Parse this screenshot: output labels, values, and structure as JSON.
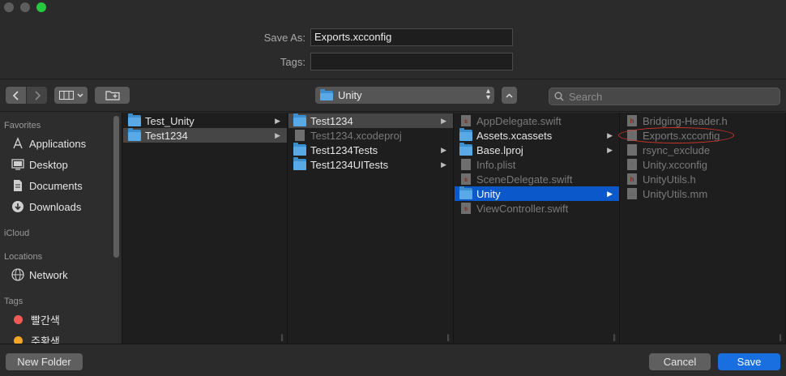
{
  "form": {
    "save_as_label": "Save As:",
    "save_as_value": "Exports.xcconfig",
    "tags_label": "Tags:",
    "tags_value": ""
  },
  "toolbar": {
    "back_icon": "chevron-left-icon",
    "forward_icon": "chevron-right-icon",
    "view_icon": "column-view-icon",
    "new_folder_icon": "folder-plus-icon",
    "location": "Unity",
    "search_placeholder": "Search"
  },
  "sidebar": {
    "favorites_label": "Favorites",
    "favorites": [
      {
        "label": "Applications",
        "icon": "applications-icon"
      },
      {
        "label": "Desktop",
        "icon": "desktop-icon"
      },
      {
        "label": "Documents",
        "icon": "documents-icon"
      },
      {
        "label": "Downloads",
        "icon": "downloads-icon"
      }
    ],
    "icloud_label": "iCloud",
    "locations_label": "Locations",
    "locations": [
      {
        "label": "Network",
        "icon": "network-icon"
      }
    ],
    "tags_label": "Tags",
    "tags": [
      {
        "label": "빨간색",
        "color": "#ef5b54"
      },
      {
        "label": "주황색",
        "color": "#f5a623"
      }
    ]
  },
  "columns": [
    [
      {
        "label": "Test_Unity",
        "type": "folder",
        "chevron": "▶"
      },
      {
        "label": "Test1234",
        "type": "folder",
        "chevron": "▶",
        "selected": "gray"
      }
    ],
    [
      {
        "label": "Test1234",
        "type": "folder",
        "chevron": "▶",
        "selected": "gray"
      },
      {
        "label": "Test1234.xcodeproj",
        "type": "doc",
        "dim": true
      },
      {
        "label": "Test1234Tests",
        "type": "folder",
        "chevron": "▶"
      },
      {
        "label": "Test1234UITests",
        "type": "folder",
        "chevron": "▶"
      }
    ],
    [
      {
        "label": "AppDelegate.swift",
        "type": "doc",
        "dim": true
      },
      {
        "label": "Assets.xcassets",
        "type": "folder",
        "chevron": "▶"
      },
      {
        "label": "Base.lproj",
        "type": "folder",
        "chevron": "▶"
      },
      {
        "label": "Info.plist",
        "type": "doc",
        "dim": true
      },
      {
        "label": "SceneDelegate.swift",
        "type": "doc",
        "dim": true
      },
      {
        "label": "Unity",
        "type": "folder",
        "chevron": "▶",
        "selected": "blue"
      },
      {
        "label": "ViewController.swift",
        "type": "doc",
        "dim": true
      }
    ],
    [
      {
        "label": "Bridging-Header.h",
        "type": "doc",
        "badge": "h",
        "dim": true
      },
      {
        "label": "Exports.xcconfig",
        "type": "doc",
        "badge": "?",
        "dim": true
      },
      {
        "label": "rsync_exclude",
        "type": "doc",
        "badge": "",
        "dim": true
      },
      {
        "label": "Unity.xcconfig",
        "type": "doc",
        "badge": "?",
        "dim": true
      },
      {
        "label": "UnityUtils.h",
        "type": "doc",
        "badge": "h",
        "dim": true
      },
      {
        "label": "UnityUtils.mm",
        "type": "doc",
        "badge": "m",
        "dim": true
      }
    ]
  ],
  "bottom": {
    "new_folder": "New Folder",
    "cancel": "Cancel",
    "save": "Save"
  }
}
